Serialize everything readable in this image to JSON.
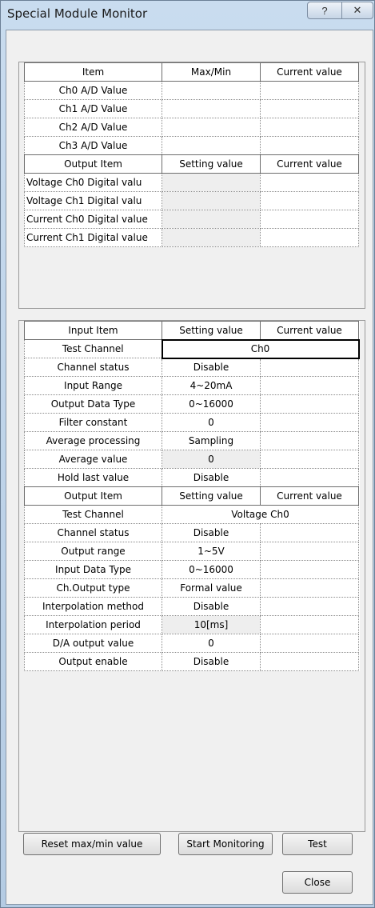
{
  "window": {
    "title": "Special Module Monitor",
    "help_glyph": "?",
    "close_glyph": "✕"
  },
  "table1": {
    "headers": [
      "Item",
      "Max/Min",
      "Current value"
    ],
    "rows": [
      [
        "Ch0 A/D Value",
        "",
        ""
      ],
      [
        "Ch1 A/D Value",
        "",
        ""
      ],
      [
        "Ch2 A/D Value",
        "",
        ""
      ],
      [
        "Ch3 A/D Value",
        "",
        ""
      ]
    ],
    "output_headers": [
      "Output Item",
      "Setting value",
      "Current value"
    ],
    "output_rows": [
      [
        "Voltage Ch0 Digital valu",
        "",
        ""
      ],
      [
        "Voltage Ch1 Digital valu",
        "",
        ""
      ],
      [
        "Current Ch0 Digital value",
        "",
        ""
      ],
      [
        "Current Ch1 Digital value",
        "",
        ""
      ]
    ]
  },
  "table2": {
    "input_headers": [
      "Input Item",
      "Setting value",
      "Current value"
    ],
    "input_test_channel": {
      "label": "Test Channel",
      "value": "Ch0"
    },
    "input_rows": [
      [
        "Channel status",
        "Disable",
        ""
      ],
      [
        "Input Range",
        "4~20mA",
        ""
      ],
      [
        "Output Data Type",
        "0~16000",
        ""
      ],
      [
        "Filter constant",
        "0",
        ""
      ],
      [
        "Average processing",
        "Sampling",
        ""
      ],
      [
        "Average value",
        "0",
        ""
      ],
      [
        "Hold last value",
        "Disable",
        ""
      ]
    ],
    "output_headers": [
      "Output Item",
      "Setting value",
      "Current value"
    ],
    "output_test_channel": {
      "label": "Test Channel",
      "value": "Voltage Ch0"
    },
    "output_rows": [
      [
        "Channel status",
        "Disable",
        ""
      ],
      [
        "Output range",
        "1~5V",
        ""
      ],
      [
        "Input Data Type",
        "0~16000",
        ""
      ],
      [
        "Ch.Output type",
        "Formal value",
        ""
      ],
      [
        "Interpolation method",
        "Disable",
        ""
      ],
      [
        "Interpolation period",
        "10[ms]",
        ""
      ],
      [
        "D/A output value",
        "0",
        ""
      ],
      [
        "Output enable",
        "Disable",
        ""
      ]
    ]
  },
  "buttons": {
    "reset": "Reset max/min value",
    "start": "Start Monitoring",
    "test": "Test",
    "close": "Close"
  }
}
